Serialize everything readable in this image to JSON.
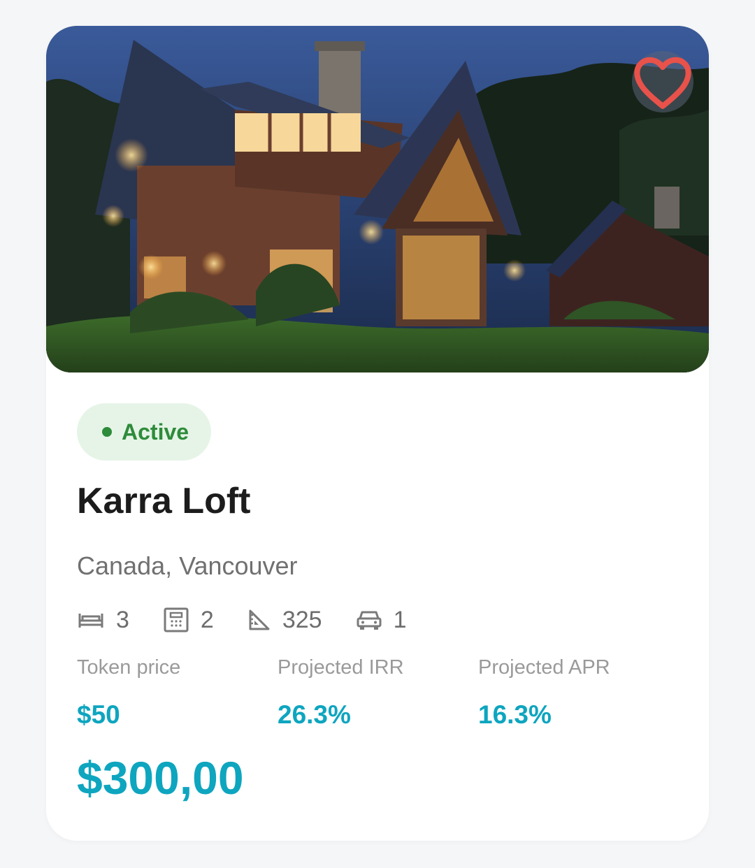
{
  "property": {
    "status": "Active",
    "name": "Karra Loft",
    "location": "Canada, Vancouver",
    "features": {
      "bedrooms": "3",
      "bathrooms": "2",
      "area": "325",
      "parking": "1"
    },
    "stats": [
      {
        "label": "Token price",
        "value": "$50"
      },
      {
        "label": "Projected IRR",
        "value": "26.3%"
      },
      {
        "label": "Projected APR",
        "value": "16.3%"
      }
    ],
    "price": "$300,00",
    "favorite_icon": "heart-outline-icon"
  },
  "colors": {
    "accent": "#0ea5bf",
    "status_green": "#2e8b3a",
    "status_bg": "#e6f4e7",
    "heart": "#e8524a"
  }
}
